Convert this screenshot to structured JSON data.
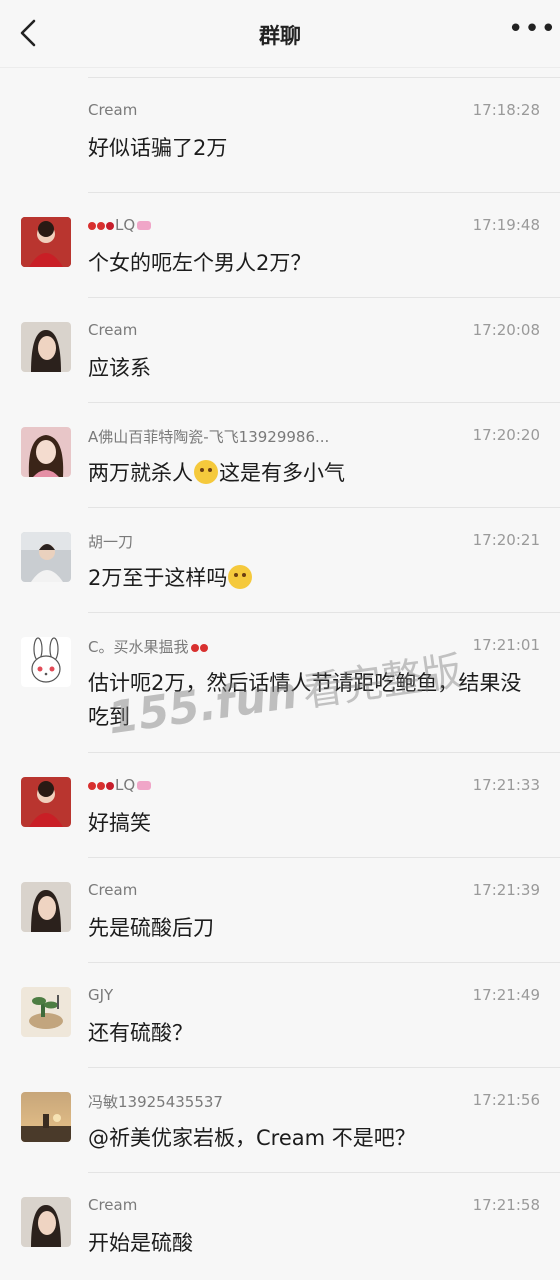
{
  "header": {
    "title": "群聊",
    "more_label": "•••"
  },
  "messages": [
    {
      "sender": "Cream",
      "time": "17:18:28",
      "text": "好似话骗了2万",
      "avatar": "none"
    },
    {
      "sender": "LQ",
      "time": "17:19:48",
      "text": "个女的呃左个男人2万？",
      "avatar": "lq"
    },
    {
      "sender": "Cream",
      "time": "17:20:08",
      "text": "应该系",
      "avatar": "cream"
    },
    {
      "sender": "A佛山百菲特陶瓷-飞飞13929986...",
      "time": "17:20:20",
      "text_a": "两万就杀人",
      "text_b": "这是有多小气",
      "emoji": "crying-laughing-emoji",
      "avatar": "feifei"
    },
    {
      "sender": "胡一刀",
      "time": "17:20:21",
      "text_a": "2万至于这样吗",
      "emoji": "crying-emoji",
      "avatar": "huyidao"
    },
    {
      "sender": "C。买水果揾我",
      "time": "17:21:01",
      "text": "估计呃2万，然后话情人节请距吃鲍鱼，结果没吃到",
      "avatar": "rabbit"
    },
    {
      "sender": "LQ",
      "time": "17:21:33",
      "text": "好搞笑",
      "avatar": "lq"
    },
    {
      "sender": "Cream",
      "time": "17:21:39",
      "text": "先是硫酸后刀",
      "avatar": "cream"
    },
    {
      "sender": "GJY",
      "time": "17:21:49",
      "text": "还有硫酸？",
      "avatar": "gjy"
    },
    {
      "sender": "冯敏13925435537",
      "time": "17:21:56",
      "text": "@祈美优家岩板，Cream 不是吧？",
      "avatar": "fengmin"
    },
    {
      "sender": "Cream",
      "time": "17:21:58",
      "text": "开始是硫酸",
      "avatar": "cream"
    }
  ],
  "watermark": {
    "site": "155.fun",
    "label": "看完整版"
  },
  "colors": {
    "background": "#f7f7f7",
    "time_text": "#9a9a9a",
    "sender_text": "#7a7a7a"
  }
}
